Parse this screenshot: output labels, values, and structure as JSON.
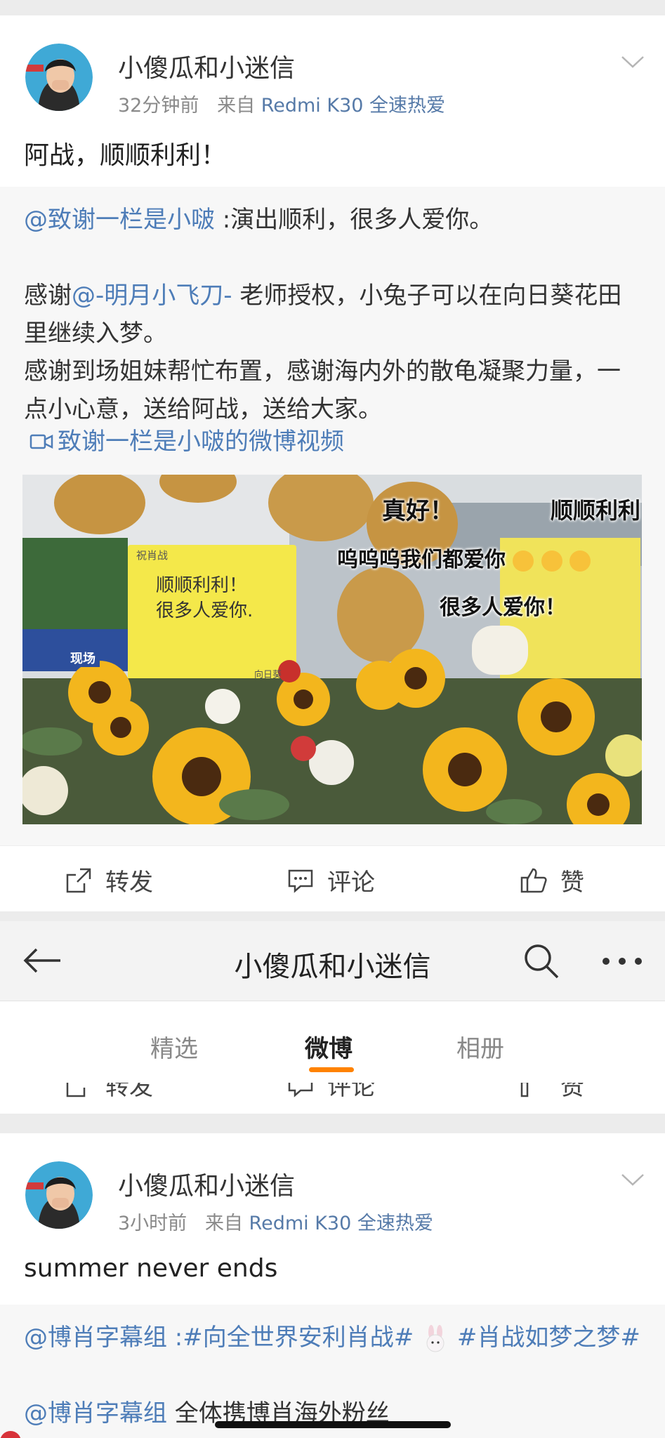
{
  "post1": {
    "author": "小傻瓜和小迷信",
    "time": "32分钟前",
    "from_prefix": "来自",
    "source": "Redmi K30 全速热爱",
    "text": "阿战，顺顺利利！",
    "retweet": {
      "mention1": "@致谢一栏是小啵",
      "text1": " :演出顺利，很多人爱你。",
      "p2_prefix": "感谢",
      "mention2": "@-明月小飞刀-",
      "p2_rest": " 老师授权，小兔子可以在向日葵花田里继续入梦。",
      "p3": "感谢到场姐妹帮忙布置，感谢海内外的散龟凝聚力量，一点小心意，送给阿战，送给大家。",
      "video_link": "致谢一栏是小啵的微博视频"
    },
    "image": {
      "stickers": [
        "真好！",
        "顺顺利利",
        "呜呜呜我们都爱你",
        "很多人爱你！"
      ],
      "sign_header": "祝肖战",
      "sign_line1": "顺顺利利！",
      "sign_line2": "很多人爱你.",
      "sign_footer": "向日葵",
      "banner": "现场"
    },
    "actions": {
      "repost": "转发",
      "comment": "评论",
      "like": "赞"
    }
  },
  "navbar": {
    "title": "小傻瓜和小迷信",
    "tabs": [
      {
        "label": "精选"
      },
      {
        "label": "微博"
      },
      {
        "label": "相册"
      }
    ]
  },
  "peek_actions": {
    "repost": "转发",
    "comment": "评论",
    "like": "赞"
  },
  "post2": {
    "author": "小傻瓜和小迷信",
    "time": "3小时前",
    "from_prefix": "来自",
    "source": "Redmi K30 全速热爱",
    "text": "summer never ends",
    "retweet": {
      "mention1": "@博肖字幕组",
      "text1": " :#向全世界安利肖战# ",
      "tag2": "#肖战如梦之梦#",
      "mention2": "@博肖字幕组",
      "text2": " 全体携博肖海外粉丝"
    }
  }
}
